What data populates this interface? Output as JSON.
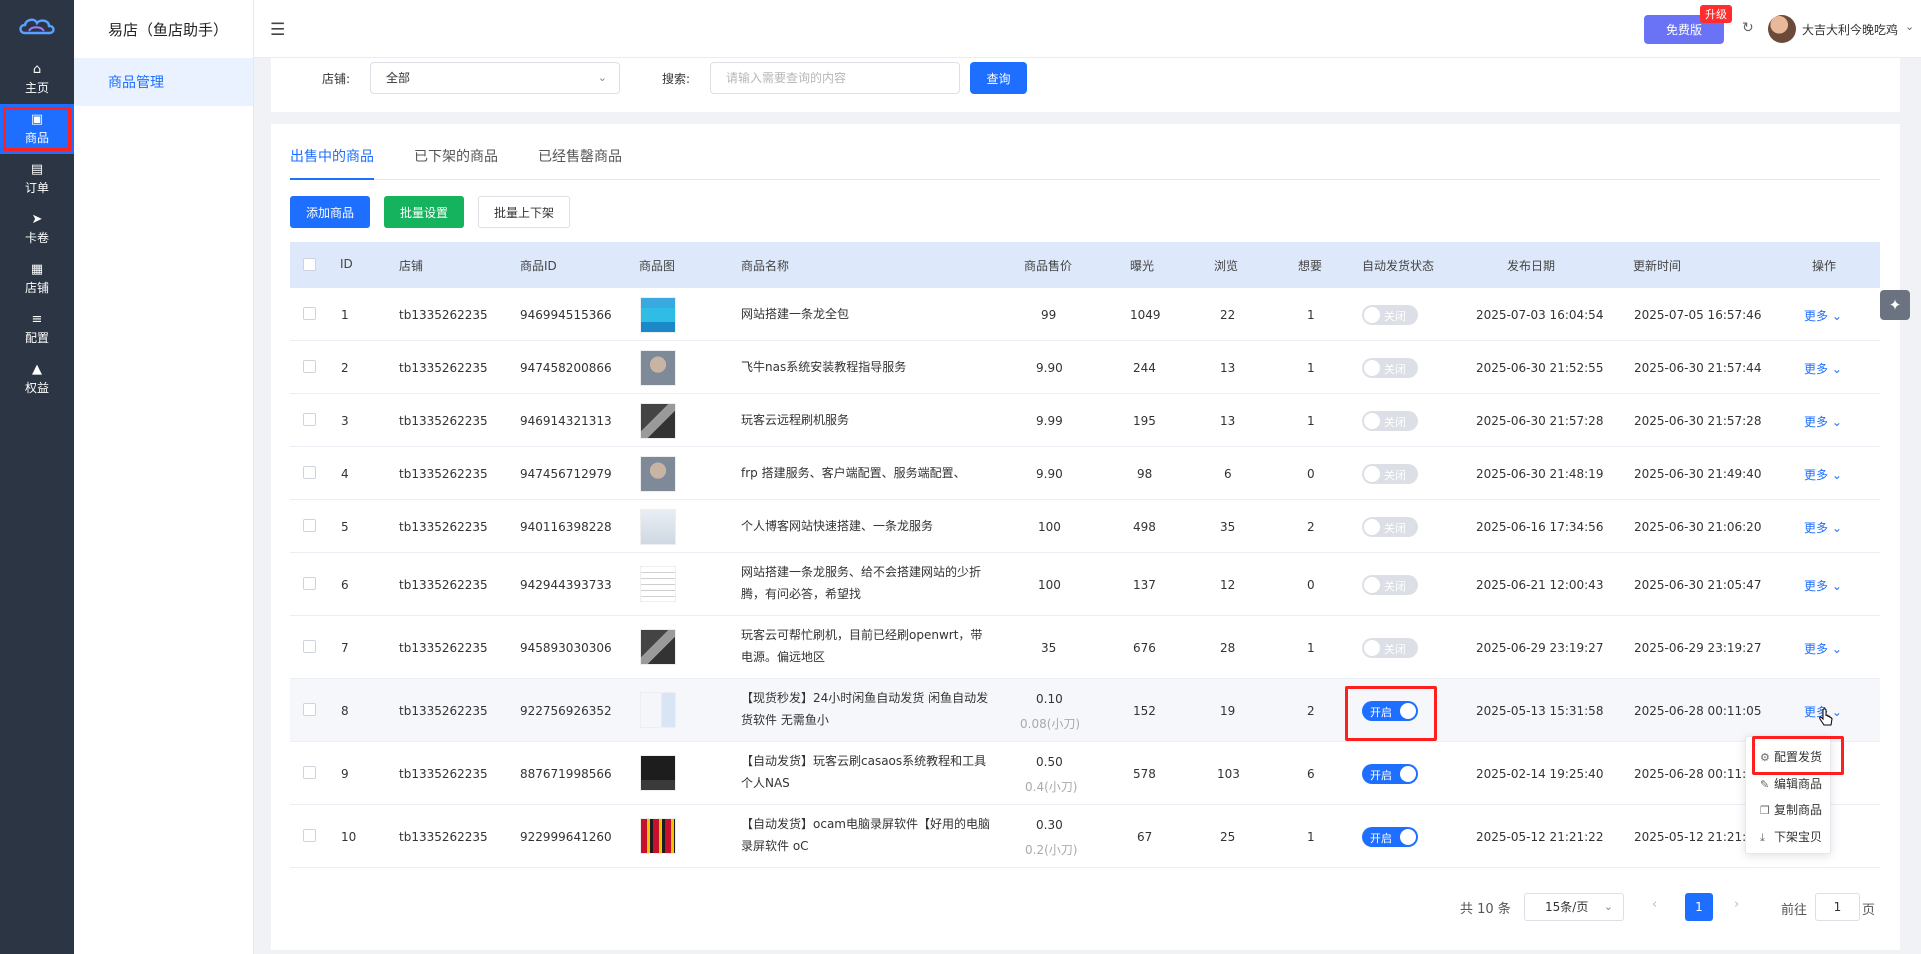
{
  "rail": [
    {
      "label": "主页",
      "icon": "home-icon",
      "glyph": "⌂"
    },
    {
      "label": "商品",
      "icon": "goods-icon",
      "glyph": "▣"
    },
    {
      "label": "订单",
      "icon": "order-icon",
      "glyph": "▤"
    },
    {
      "label": "卡卷",
      "icon": "ticket-icon",
      "glyph": "➤"
    },
    {
      "label": "店铺",
      "icon": "shop-icon",
      "glyph": "▦"
    },
    {
      "label": "配置",
      "icon": "config-icon",
      "glyph": "≡"
    },
    {
      "label": "权益",
      "icon": "rights-icon",
      "glyph": "▲"
    }
  ],
  "app_title": "易店（鱼店助手）",
  "menu_item": "商品管理",
  "header": {
    "free_label": "免费版",
    "upgrade_badge": "升级",
    "username": "大吉大利今晚吃鸡"
  },
  "search": {
    "shop_label": "店铺:",
    "shop_value": "全部",
    "search_label": "搜索:",
    "search_placeholder": "请输入需要查询的内容",
    "query_button": "查询"
  },
  "tabs": [
    "出售中的商品",
    "已下架的商品",
    "已经售罄商品"
  ],
  "actions": {
    "add": "添加商品",
    "batch_set": "批量设置",
    "batch_shelf": "批量上下架"
  },
  "columns": [
    "ID",
    "店铺",
    "商品ID",
    "商品图",
    "商品名称",
    "商品售价",
    "曝光",
    "浏览",
    "想要",
    "自动发货状态",
    "发布日期",
    "更新时间",
    "操作"
  ],
  "rows": [
    {
      "id": "1",
      "shop": "tb1335262235",
      "pid": "946994515366",
      "name": "网站搭建一条龙全包",
      "price": "99",
      "price_sub": "",
      "exposure": "1049",
      "views": "22",
      "wants": "1",
      "status": "关闭",
      "on": false,
      "published": "2025-07-03 16:04:54",
      "updated": "2025-07-05 16:57:46",
      "more": "更多"
    },
    {
      "id": "2",
      "shop": "tb1335262235",
      "pid": "947458200866",
      "name": "飞牛nas系统安装教程指导服务",
      "price": "9.90",
      "price_sub": "",
      "exposure": "244",
      "views": "13",
      "wants": "1",
      "status": "关闭",
      "on": false,
      "published": "2025-06-30 21:52:55",
      "updated": "2025-06-30 21:57:44",
      "more": "更多"
    },
    {
      "id": "3",
      "shop": "tb1335262235",
      "pid": "946914321313",
      "name": "玩客云远程刷机服务",
      "price": "9.99",
      "price_sub": "",
      "exposure": "195",
      "views": "13",
      "wants": "1",
      "status": "关闭",
      "on": false,
      "published": "2025-06-30 21:57:28",
      "updated": "2025-06-30 21:57:28",
      "more": "更多"
    },
    {
      "id": "4",
      "shop": "tb1335262235",
      "pid": "947456712979",
      "name": "frp 搭建服务、客户端配置、服务端配置、",
      "price": "9.90",
      "price_sub": "",
      "exposure": "98",
      "views": "6",
      "wants": "0",
      "status": "关闭",
      "on": false,
      "published": "2025-06-30 21:48:19",
      "updated": "2025-06-30 21:49:40",
      "more": "更多"
    },
    {
      "id": "5",
      "shop": "tb1335262235",
      "pid": "940116398228",
      "name": "个人博客网站快速搭建、一条龙服务",
      "price": "100",
      "price_sub": "",
      "exposure": "498",
      "views": "35",
      "wants": "2",
      "status": "关闭",
      "on": false,
      "published": "2025-06-16 17:34:56",
      "updated": "2025-06-30 21:06:20",
      "more": "更多"
    },
    {
      "id": "6",
      "shop": "tb1335262235",
      "pid": "942944393733",
      "name": "网站搭建一条龙服务、给不会搭建网站的少折腾，有问必答，希望找",
      "price": "100",
      "price_sub": "",
      "exposure": "137",
      "views": "12",
      "wants": "0",
      "status": "关闭",
      "on": false,
      "published": "2025-06-21 12:00:43",
      "updated": "2025-06-30 21:05:47",
      "more": "更多"
    },
    {
      "id": "7",
      "shop": "tb1335262235",
      "pid": "945893030306",
      "name": "玩客云可帮忙刷机，目前已经刷openwrt，带电源。偏远地区",
      "price": "35",
      "price_sub": "",
      "exposure": "676",
      "views": "28",
      "wants": "1",
      "status": "关闭",
      "on": false,
      "published": "2025-06-29 23:19:27",
      "updated": "2025-06-29 23:19:27",
      "more": "更多"
    },
    {
      "id": "8",
      "shop": "tb1335262235",
      "pid": "922756926352",
      "name": "【现货秒发】24小时闲鱼自动发货 闲鱼自动发货软件 无需鱼小",
      "price": "0.10",
      "price_sub": "0.08(小刀)",
      "exposure": "152",
      "views": "19",
      "wants": "2",
      "status": "开启",
      "on": true,
      "published": "2025-05-13 15:31:58",
      "updated": "2025-06-28 00:11:05",
      "more": "更多"
    },
    {
      "id": "9",
      "shop": "tb1335262235",
      "pid": "887671998566",
      "name": "【自动发货】玩客云刷casaos系统教程和工具个人NAS",
      "price": "0.50",
      "price_sub": "0.4(小刀)",
      "exposure": "578",
      "views": "103",
      "wants": "6",
      "status": "开启",
      "on": true,
      "published": "2025-02-14 19:25:40",
      "updated": "2025-06-28 00:11:00",
      "more": ""
    },
    {
      "id": "10",
      "shop": "tb1335262235",
      "pid": "922999641260",
      "name": "【自动发货】ocam电脑录屏软件【好用的电脑 录屏软件 oC",
      "price": "0.30",
      "price_sub": "0.2(小刀)",
      "exposure": "67",
      "views": "25",
      "wants": "1",
      "status": "开启",
      "on": true,
      "published": "2025-05-12 21:21:22",
      "updated": "2025-05-12 21:21:58",
      "more": ""
    }
  ],
  "dropdown": [
    {
      "label": "配置发货",
      "icon": "settings-icon",
      "glyph": "⚙"
    },
    {
      "label": "编辑商品",
      "icon": "edit-icon",
      "glyph": "✎"
    },
    {
      "label": "复制商品",
      "icon": "copy-icon",
      "glyph": "❐"
    },
    {
      "label": "下架宝贝",
      "icon": "download-icon",
      "glyph": "⤓"
    }
  ],
  "pagination": {
    "total": "共 10 条",
    "page_size": "15条/页",
    "current": "1",
    "goto_label": "前往",
    "goto_value": "1",
    "page_suffix": "页"
  },
  "colors": {
    "primary": "#1e6fff",
    "green": "#16b35f",
    "rail": "#2b3544",
    "highlight": "#ff1f1f"
  }
}
